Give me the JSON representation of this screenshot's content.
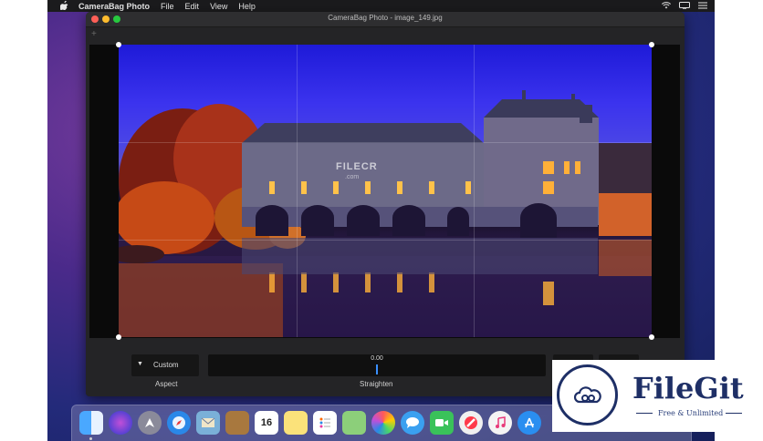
{
  "menubar": {
    "app_name": "CameraBag Photo",
    "menus": [
      "File",
      "Edit",
      "View",
      "Help"
    ]
  },
  "window": {
    "title": "CameraBag Photo - image_149.jpg",
    "add_label": "+"
  },
  "controls": {
    "aspect": {
      "value": "Custom",
      "label": "Aspect"
    },
    "straighten": {
      "value": "0.00",
      "label": "Straighten",
      "level": 0.0
    }
  },
  "photo": {
    "watermark": "FILECR",
    "watermark_sub": ".com"
  },
  "dock": {
    "apps": [
      "finder-icon",
      "siri-icon",
      "launchpad-icon",
      "safari-icon",
      "mail-icon",
      "notes-book-icon",
      "calendar-icon",
      "notes-icon",
      "reminders-icon",
      "maps-icon",
      "photos-icon",
      "messages-icon",
      "facetime-icon",
      "news-icon",
      "music-icon",
      "app-store-icon"
    ],
    "calendar_day": "16"
  },
  "overlay": {
    "brand": "FileGit",
    "tagline": "Free & Unlimited"
  },
  "colors": {
    "accent": "#3a8fff",
    "brand": "#1e2f66"
  }
}
